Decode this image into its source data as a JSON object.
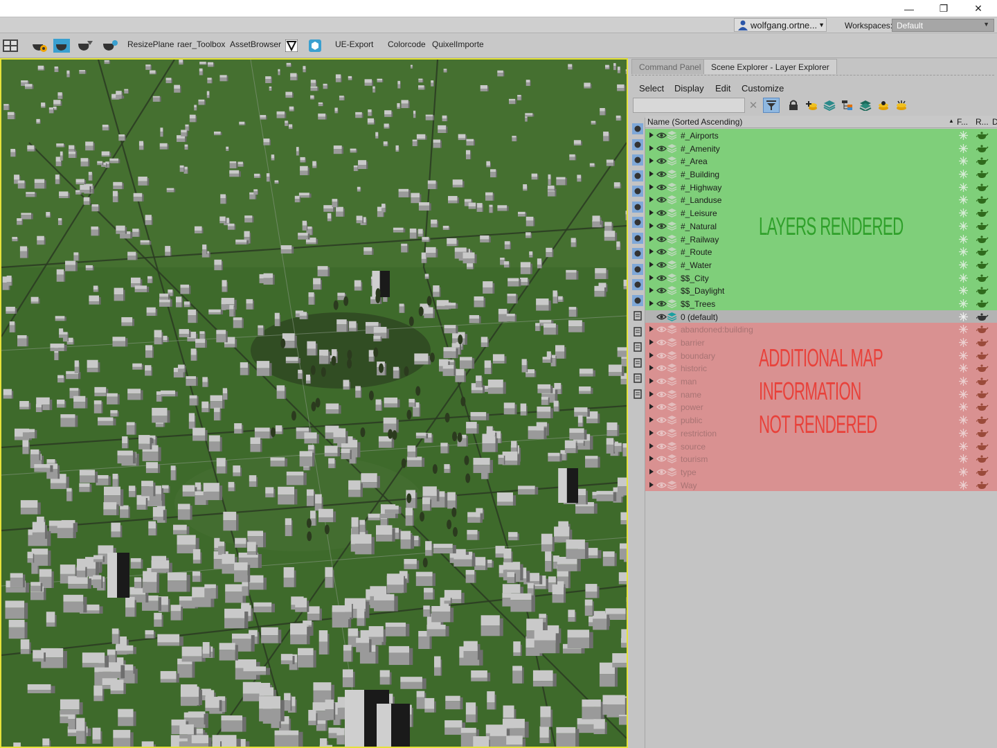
{
  "window": {
    "minimize": "—",
    "restore": "❐",
    "close": "✕"
  },
  "userbar": {
    "username": "wolfgang.ortne...",
    "workspaces_label": "Workspaces:",
    "workspace_value": "Default"
  },
  "toolbar": {
    "items": [
      "ResizePlane",
      "raer_Toolbox",
      "AssetBrowser",
      "UE-Export",
      "Colorcode",
      "QuixelImporter"
    ]
  },
  "panel": {
    "tabs": [
      "Command Panel",
      "Scene Explorer - Layer Explorer"
    ],
    "menus": [
      "Select",
      "Display",
      "Edit",
      "Customize"
    ],
    "column_name": "Name (Sorted Ascending)",
    "column_f": "F...",
    "column_r": "R...",
    "column_d": "D"
  },
  "layers_rendered": [
    "#_Airports",
    "#_Amenity",
    "#_Area",
    "#_Building",
    "#_Highway",
    "#_Landuse",
    "#_Leisure",
    "#_Natural",
    "#_Railway",
    "#_Route",
    "#_Water",
    "$$_City",
    "$$_Daylight",
    "$$_Trees"
  ],
  "default_layer": "0 (default)",
  "layers_not_rendered": [
    "abandoned:building",
    "barrier",
    "boundary",
    "historic",
    "man",
    "name",
    "power",
    "public",
    "restriction",
    "source",
    "tourism",
    "type",
    "Way"
  ],
  "annotations": {
    "rendered": "LAYERS RENDERED",
    "not_rendered_1": "ADDITIONAL MAP",
    "not_rendered_2": "INFORMATION",
    "not_rendered_3": "NOT RENDERED"
  },
  "colors": {
    "rendered_row": "#7fcf7a",
    "not_rendered_row": "#d99191",
    "annot_green": "#2fa02a",
    "annot_red": "#e8413a",
    "viewport_border": "#e5e23a"
  }
}
